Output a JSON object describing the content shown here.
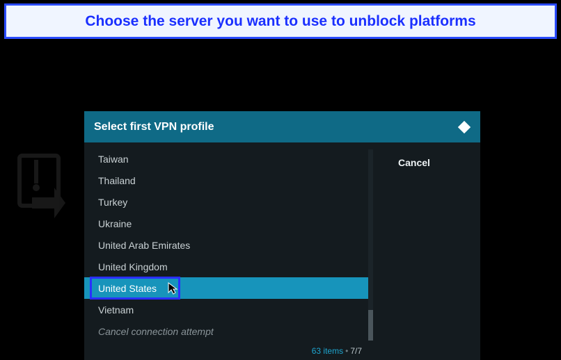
{
  "annotation": {
    "text": "Choose the server you want to use to unblock platforms"
  },
  "dialog": {
    "title": "Select  first VPN profile",
    "cancel_label": "Cancel",
    "footer_count": "63 items",
    "footer_page": "7/7",
    "items": [
      {
        "label": "Taiwan",
        "highlighted": false
      },
      {
        "label": "Thailand",
        "highlighted": false
      },
      {
        "label": "Turkey",
        "highlighted": false
      },
      {
        "label": "Ukraine",
        "highlighted": false
      },
      {
        "label": "United Arab Emirates",
        "highlighted": false
      },
      {
        "label": "United Kingdom",
        "highlighted": false
      },
      {
        "label": "United States",
        "highlighted": true
      },
      {
        "label": "Vietnam",
        "highlighted": false
      },
      {
        "label": "Cancel connection attempt",
        "highlighted": false,
        "italic": true
      }
    ]
  }
}
